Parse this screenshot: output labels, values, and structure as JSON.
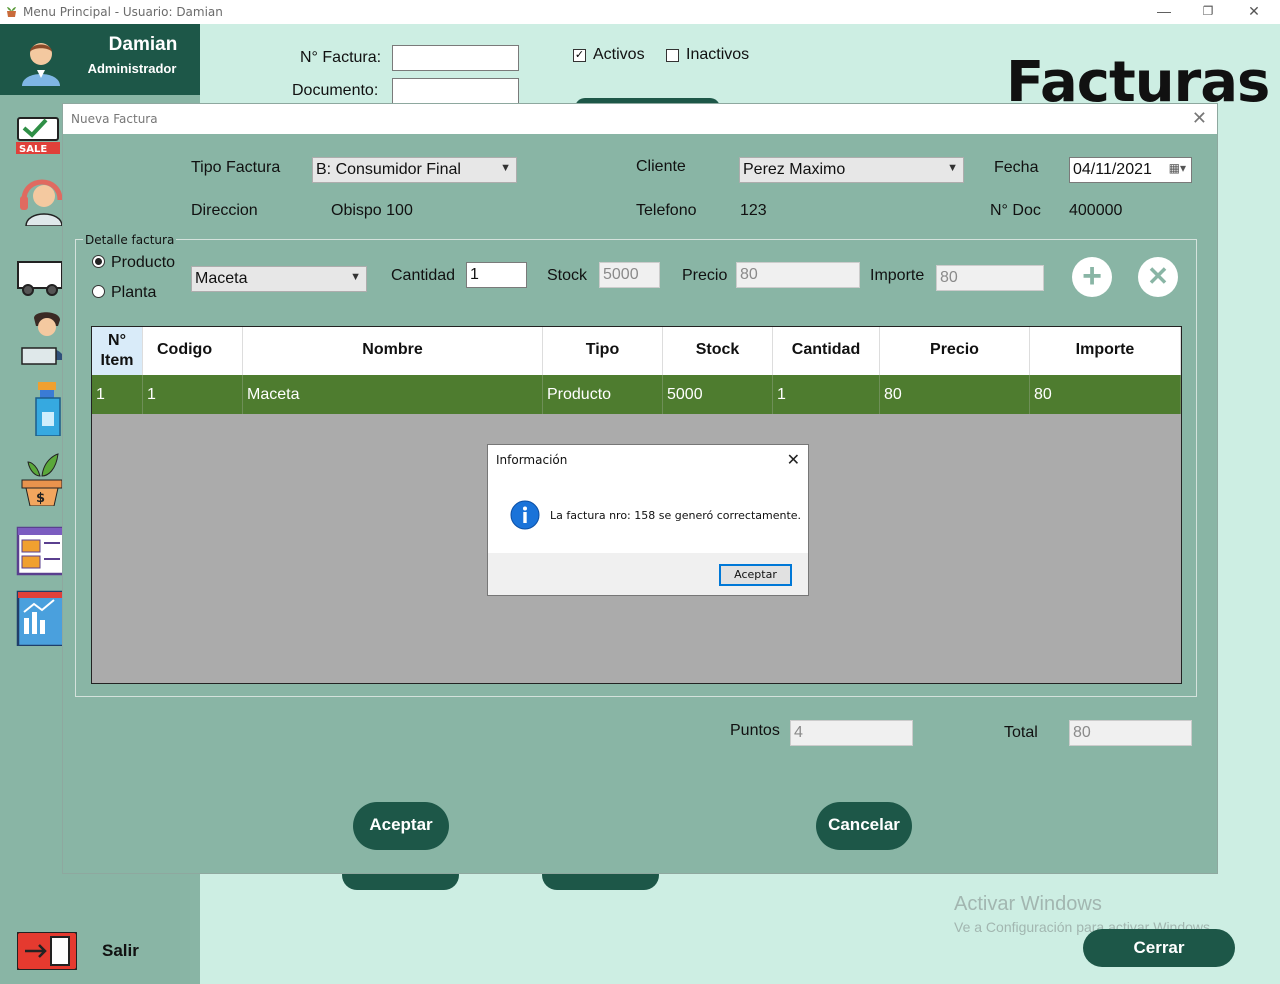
{
  "window": {
    "title": "Menu Principal - Usuario: Damian",
    "minimize": "—",
    "restore": "❐",
    "close": "✕"
  },
  "user": {
    "name": "Damian",
    "role": "Administrador"
  },
  "sidebar": {
    "icons": [
      "sale-tag-icon",
      "support-agent-icon",
      "delivery-truck-icon",
      "employee-laptop-icon",
      "spray-bottle-icon",
      "plant-pot-money-icon",
      "dashboard-report-icon",
      "analytics-chart-icon"
    ],
    "exit_label": "Salir"
  },
  "filters": {
    "factura_label": "N° Factura:",
    "factura_value": "",
    "documento_label": "Documento:",
    "documento_value": "",
    "activos_label": "Activos",
    "activos_checked": true,
    "inactivos_label": "Inactivos",
    "inactivos_checked": false
  },
  "page_title": "Facturas",
  "cerrar_label": "Cerrar",
  "watermark": {
    "line1": "Activar Windows",
    "line2": "Ve a Configuración para activar Windows."
  },
  "dialog": {
    "title": "Nueva Factura",
    "close": "✕",
    "tipo_factura_label": "Tipo Factura",
    "tipo_factura_value": "B: Consumidor Final",
    "cliente_label": "Cliente",
    "cliente_value": "Perez Maximo",
    "fecha_label": "Fecha",
    "fecha_value": "04/11/2021",
    "direccion_label": "Direccion",
    "direccion_value": "Obispo 100",
    "telefono_label": "Telefono",
    "telefono_value": "123",
    "ndoc_label": "N° Doc",
    "ndoc_value": "400000",
    "group_title": "Detalle factura",
    "radio_producto": "Producto",
    "radio_planta": "Planta",
    "producto_selected": "Maceta",
    "cantidad_label": "Cantidad",
    "cantidad_value": "1",
    "stock_label": "Stock",
    "stock_value": "5000",
    "precio_label": "Precio",
    "precio_value": "80",
    "importe_label": "Importe",
    "importe_value": "80",
    "add_glyph": "+",
    "remove_glyph": "✕",
    "table": {
      "headers": [
        "N°\nItem",
        "Codigo",
        "Nombre",
        "Tipo",
        "Stock",
        "Cantidad",
        "Precio",
        "Importe"
      ],
      "rows": [
        [
          "1",
          "1",
          "Maceta",
          "Producto",
          "5000",
          "1",
          "80",
          "80"
        ]
      ]
    },
    "puntos_label": "Puntos",
    "puntos_value": "4",
    "total_label": "Total",
    "total_value": "80",
    "aceptar_label": "Aceptar",
    "cancelar_label": "Cancelar"
  },
  "messagebox": {
    "title": "Información",
    "close": "✕",
    "text": "La factura nro: 158 se generó correctamente.",
    "button": "Aceptar"
  }
}
